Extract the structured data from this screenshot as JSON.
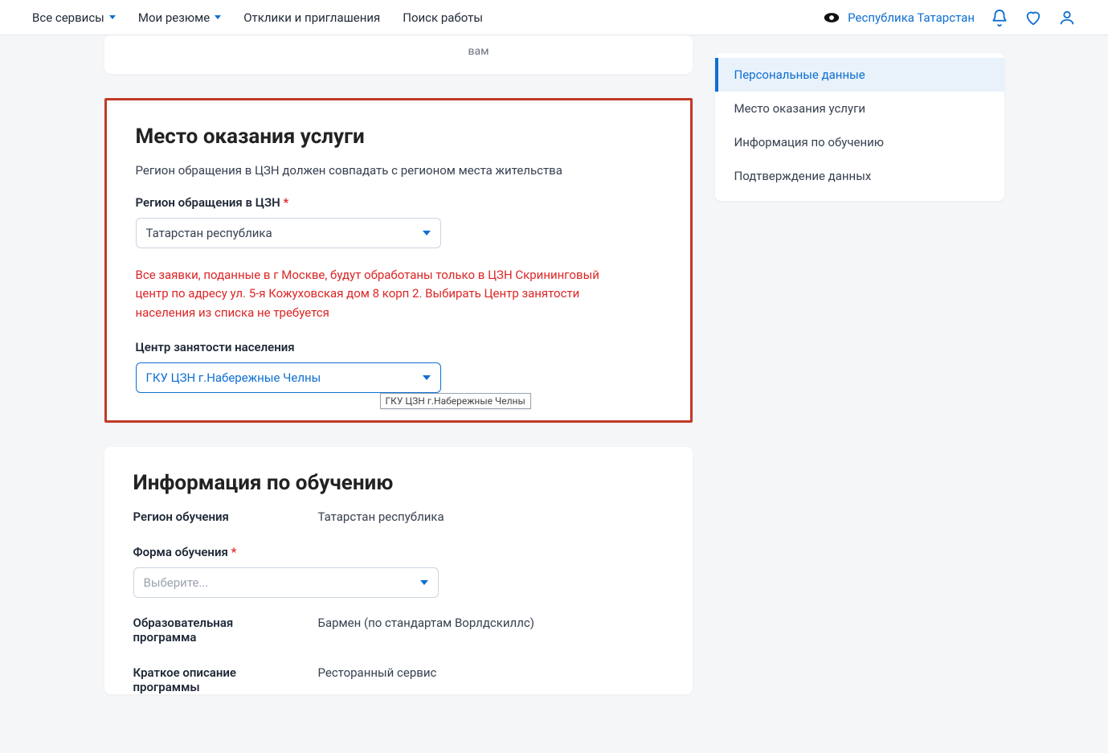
{
  "nav": {
    "all_services": "Все сервисы",
    "my_resumes": "Мои резюме",
    "responses": "Отклики и приглашения",
    "job_search": "Поиск работы"
  },
  "region_link": "Республика Татарстан",
  "partial_top": {
    "vam": "вам"
  },
  "service_location": {
    "title": "Место оказания услуги",
    "hint": "Регион обращения в ЦЗН должен совпадать с регионом места жительства",
    "region_label": "Регион обращения в ЦЗН",
    "region_value": "Татарстан республика",
    "warning": "Все заявки, поданные в г Москве, будут обработаны только в ЦЗН Скрининговый центр по адресу ул. 5-я Кожуховская дом 8 корп 2. Выбирать Центр занятости населения из списка не требуется",
    "center_label": "Центр занятости населения",
    "center_value": "ГКУ ЦЗН г.Набережные Челны",
    "tooltip": "ГКУ ЦЗН г.Набережные Челны"
  },
  "education": {
    "title": "Информация по обучению",
    "region_label": "Регион обучения",
    "region_value": "Татарстан республика",
    "form_label": "Форма обучения",
    "form_placeholder": "Выберите...",
    "program_label": "Образовательная программа",
    "program_value": "Бармен (по стандартам Ворлдскиллс)",
    "desc_label": "Краткое описание программы",
    "desc_value": "Ресторанный сервис"
  },
  "sidebar": {
    "item1": "Персональные данные",
    "item2": "Место оказания услуги",
    "item3": "Информация по обучению",
    "item4": "Подтверждение данных"
  }
}
